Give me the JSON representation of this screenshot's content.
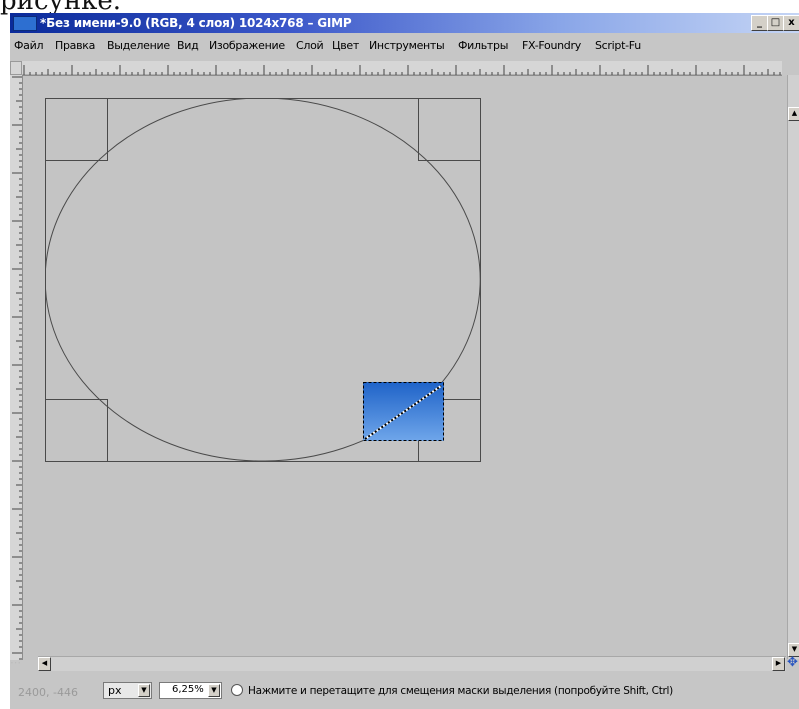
{
  "window": {
    "title": "*Без имени-9.0 (RGB, 4 слоя) 1024x768 – GIMP",
    "buttons": {
      "minimize": "_",
      "maximize": "□",
      "close": "x"
    }
  },
  "menu": [
    "Файл",
    "Правка",
    "Выделение",
    "Вид",
    "Изображение",
    "Слой",
    "Цвет",
    "Инструменты",
    "Фильтры",
    "FX-Foundry",
    "Script-Fu"
  ],
  "statusbar": {
    "coords": "2400, -446",
    "unit": "px",
    "zoom": "6,25%",
    "message": "Нажмите и перетащите для смещения маски выделения (попробуйте Shift, Ctrl)"
  },
  "colors": {
    "titlebar_start": "#0a2a9a",
    "canvas_bg": "#c4c4c4",
    "selection_fill_top": "#1f63c8",
    "selection_fill_bottom": "#6fa6ea"
  },
  "icons": [
    "app-icon",
    "minimize-icon",
    "maximize-icon",
    "close-icon",
    "scroll-up-arrow-icon",
    "scroll-down-arrow-icon",
    "scroll-left-arrow-icon",
    "scroll-right-arrow-icon",
    "navigate-icon",
    "quick-mask-icon",
    "pointer-icon",
    "dropdown-arrow-icon"
  ]
}
